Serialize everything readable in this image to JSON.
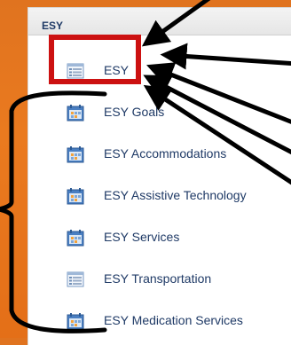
{
  "panel": {
    "title": "ESY",
    "items": [
      {
        "label": "ESY",
        "icon": "list-page-icon"
      },
      {
        "label": "ESY Goals",
        "icon": "calendar-icon"
      },
      {
        "label": "ESY Accommodations",
        "icon": "calendar-icon"
      },
      {
        "label": "ESY Assistive Technology",
        "icon": "calendar-icon"
      },
      {
        "label": "ESY Services",
        "icon": "calendar-icon"
      },
      {
        "label": "ESY Transportation",
        "icon": "list-page-icon"
      },
      {
        "label": "ESY Medication Services",
        "icon": "calendar-icon"
      }
    ]
  },
  "colors": {
    "background_orange": "#e8761d",
    "highlight_red": "#cc1111",
    "text_navy": "#1f3a66",
    "annotation_black": "#000000"
  }
}
